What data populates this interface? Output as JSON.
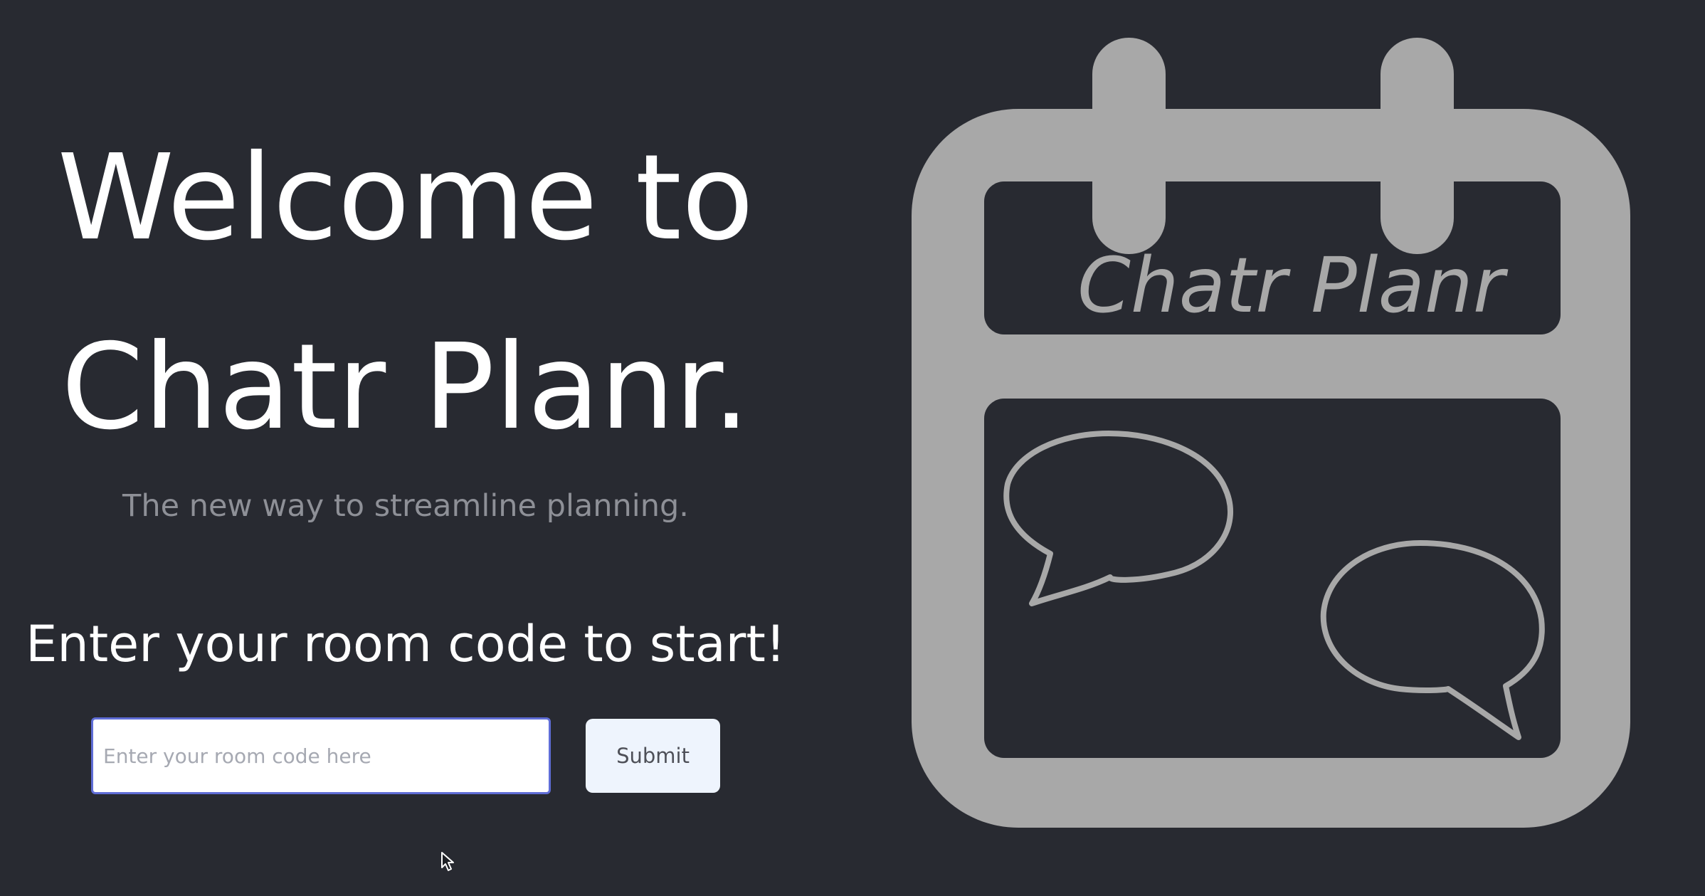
{
  "hero": {
    "welcome_line1": "Welcome to",
    "welcome_line2": "Chatr Planr.",
    "tagline": "The new way to streamline planning.",
    "prompt": "Enter your room code to start!"
  },
  "room_form": {
    "input_value": "",
    "input_placeholder": "Enter your room code here",
    "submit_label": "Submit"
  },
  "logo": {
    "wordmark": "Chatr Planr",
    "icon": "calendar-with-chat-bubbles-icon"
  },
  "colors": {
    "background": "#282a31",
    "heading_text": "#ffffff",
    "tagline_text": "#8e9097",
    "logo_gray": "#a8a8a8",
    "input_focus_border": "#5f6dd6",
    "submit_background": "#eef4fd"
  }
}
